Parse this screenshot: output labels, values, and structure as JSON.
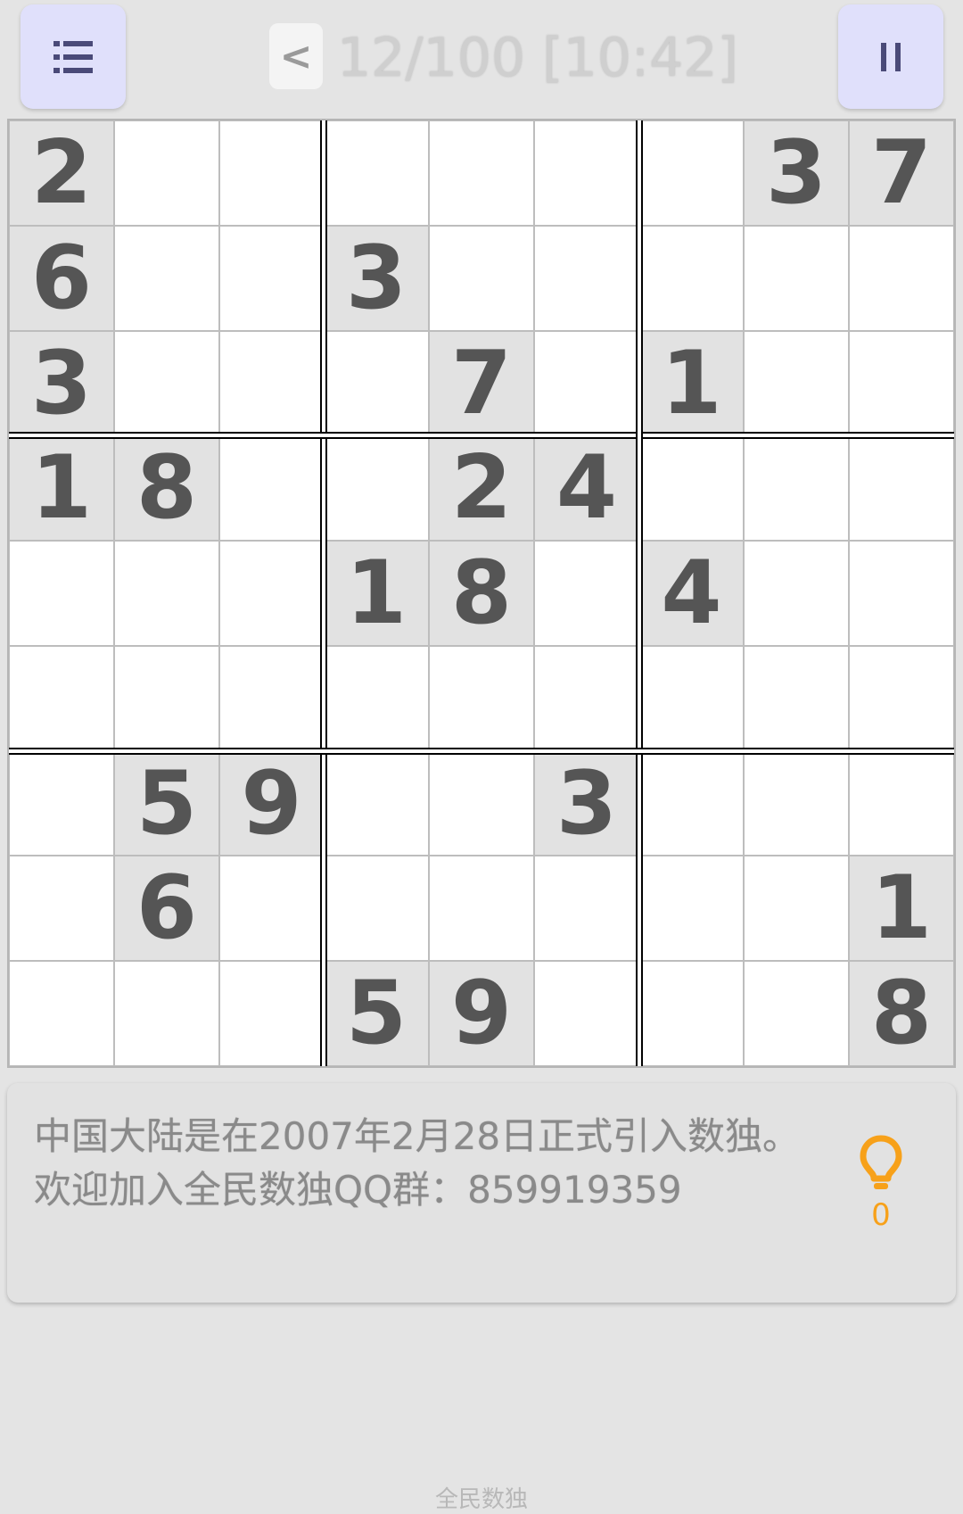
{
  "header": {
    "back_label": "<",
    "title": "12/100 [10:42]"
  },
  "board": {
    "rows": [
      [
        "2",
        "",
        "",
        "",
        "",
        "",
        "",
        "3",
        "7"
      ],
      [
        "6",
        "",
        "",
        "3",
        "",
        "",
        "",
        "",
        ""
      ],
      [
        "3",
        "",
        "",
        "",
        "7",
        "",
        "1",
        "",
        ""
      ],
      [
        "1",
        "8",
        "",
        "",
        "2",
        "4",
        "",
        "",
        ""
      ],
      [
        "",
        "",
        "",
        "1",
        "8",
        "",
        "4",
        "",
        ""
      ],
      [
        "",
        "",
        "",
        "",
        "",
        "",
        "",
        "",
        ""
      ],
      [
        "",
        "5",
        "9",
        "",
        "",
        "3",
        "",
        "",
        ""
      ],
      [
        "",
        "6",
        "",
        "",
        "",
        "",
        "",
        "",
        "1"
      ],
      [
        "",
        "",
        "",
        "5",
        "9",
        "",
        "",
        "",
        "8"
      ]
    ]
  },
  "info": {
    "line1": "中国大陆是在2007年2月28日正式引入数独。",
    "line2": "欢迎加入全民数独QQ群：859919359"
  },
  "hints": {
    "count": "0",
    "icon": "lightbulb-icon",
    "color": "#f7a11a"
  },
  "footer": {
    "label": "全民数独"
  },
  "colors": {
    "button_bg": "#e0e0fb",
    "given_cell_bg": "#e2e2e2",
    "digit": "#555555"
  }
}
